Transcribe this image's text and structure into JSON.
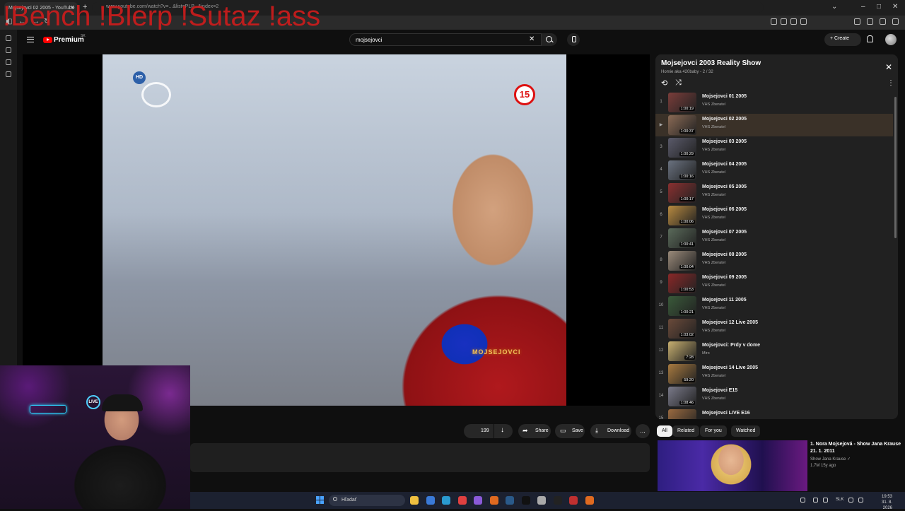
{
  "browser": {
    "tab_title": "Mojsejovci 02 2005 - YouTube",
    "new_tab": "+",
    "url": "www.youtube.com/watch?v=...&list=PLP...&index=2",
    "overlay_text": "!Bench !Blerp !Sutaz !ass"
  },
  "header": {
    "brand": "Premium",
    "country": "SK",
    "search_value": "mojsejovci",
    "create_label": "Create"
  },
  "video": {
    "hd_badge": "HD",
    "age_rating": "15",
    "show_logo": "MOJSEJOVCI"
  },
  "actions": {
    "likes": "199",
    "share_label": "Share",
    "save_label": "Save",
    "download_label": "Download",
    "more_label": "..."
  },
  "webcam": {
    "live_badge": "LIVE"
  },
  "playlist": {
    "title": "Mojsejovci 2003 Reality Show",
    "subtitle": "Homie aka 420baby - 2 / 32",
    "items": [
      {
        "index": "1",
        "title": "Mojsejovci 01 2005",
        "channel": "VHS Zberatel",
        "duration": "1:00:19",
        "color": "#7a3d3a"
      },
      {
        "index": "▶",
        "title": "Mojsejovci 02 2005",
        "channel": "VHS Zberatel",
        "duration": "1:00:37",
        "color": "#8a6a55"
      },
      {
        "index": "3",
        "title": "Mojsejovci 03 2005",
        "channel": "VHS Zberatel",
        "duration": "1:00:29",
        "color": "#5a5a6a"
      },
      {
        "index": "4",
        "title": "Mojsejovci 04 2005",
        "channel": "VHS Zberatel",
        "duration": "1:00:16",
        "color": "#6a7280"
      },
      {
        "index": "5",
        "title": "Mojsejovci 05 2005",
        "channel": "VHS Zberatel",
        "duration": "1:00:17",
        "color": "#8a3030"
      },
      {
        "index": "6",
        "title": "Mojsejovci 06 2005",
        "channel": "VHS Zberatel",
        "duration": "1:00:06",
        "color": "#b88a40"
      },
      {
        "index": "7",
        "title": "Mojsejovci 07 2005",
        "channel": "VHS Zberatel",
        "duration": "1:00:41",
        "color": "#5a6a5a"
      },
      {
        "index": "8",
        "title": "Mojsejovci 08 2005",
        "channel": "VHS Zberatel",
        "duration": "1:00:04",
        "color": "#9a8a7a"
      },
      {
        "index": "9",
        "title": "Mojsejovci 09 2005",
        "channel": "VHS Zberatel",
        "duration": "1:00:53",
        "color": "#8a2828"
      },
      {
        "index": "10",
        "title": "Mojsejovci 11 2005",
        "channel": "VHS Zberatel",
        "duration": "1:00:21",
        "color": "#3a5a3a"
      },
      {
        "index": "11",
        "title": "Mojsejovci 12 Live 2005",
        "channel": "VHS Zberatel",
        "duration": "1:03:02",
        "color": "#6a4a3a"
      },
      {
        "index": "12",
        "title": "Mojsejovci: Prdy v dome",
        "channel": "Miro",
        "duration": "7:28",
        "color": "#c8b070"
      },
      {
        "index": "13",
        "title": "Mojsejovci 14 Live 2005",
        "channel": "VHS Zberatel",
        "duration": "59:20",
        "color": "#a87a40"
      },
      {
        "index": "14",
        "title": "Mojsejovci E15",
        "channel": "VHS Zberatel",
        "duration": "1:08:46",
        "color": "#7a7a8a"
      },
      {
        "index": "15",
        "title": "Mojsejovci LIVE E16",
        "channel": "",
        "duration": "",
        "color": "#9a6a40"
      }
    ]
  },
  "chips": [
    {
      "label": "All",
      "active": true
    },
    {
      "label": "Related",
      "active": false
    },
    {
      "label": "For you",
      "active": false
    },
    {
      "label": "Watched",
      "active": false
    }
  ],
  "recommendation": {
    "title": "1. Nora Mojsejová - Show Jana Krause 21. 1. 2011",
    "channel": "Show Jana Krause ✓",
    "meta": "1.7M  15y ago"
  },
  "taskbar": {
    "search_label": "Hľadať",
    "language": "SLK",
    "time": "19:53",
    "date": "31. 8. 2026",
    "apps": [
      "#f0c040",
      "#3a7ad8",
      "#2a9ad0",
      "#e04040",
      "#8a5ad8",
      "#e06a20",
      "#2a5a8a",
      "#111111",
      "#aaaaaa",
      "#222222",
      "#c03030",
      "#e06a20"
    ]
  }
}
